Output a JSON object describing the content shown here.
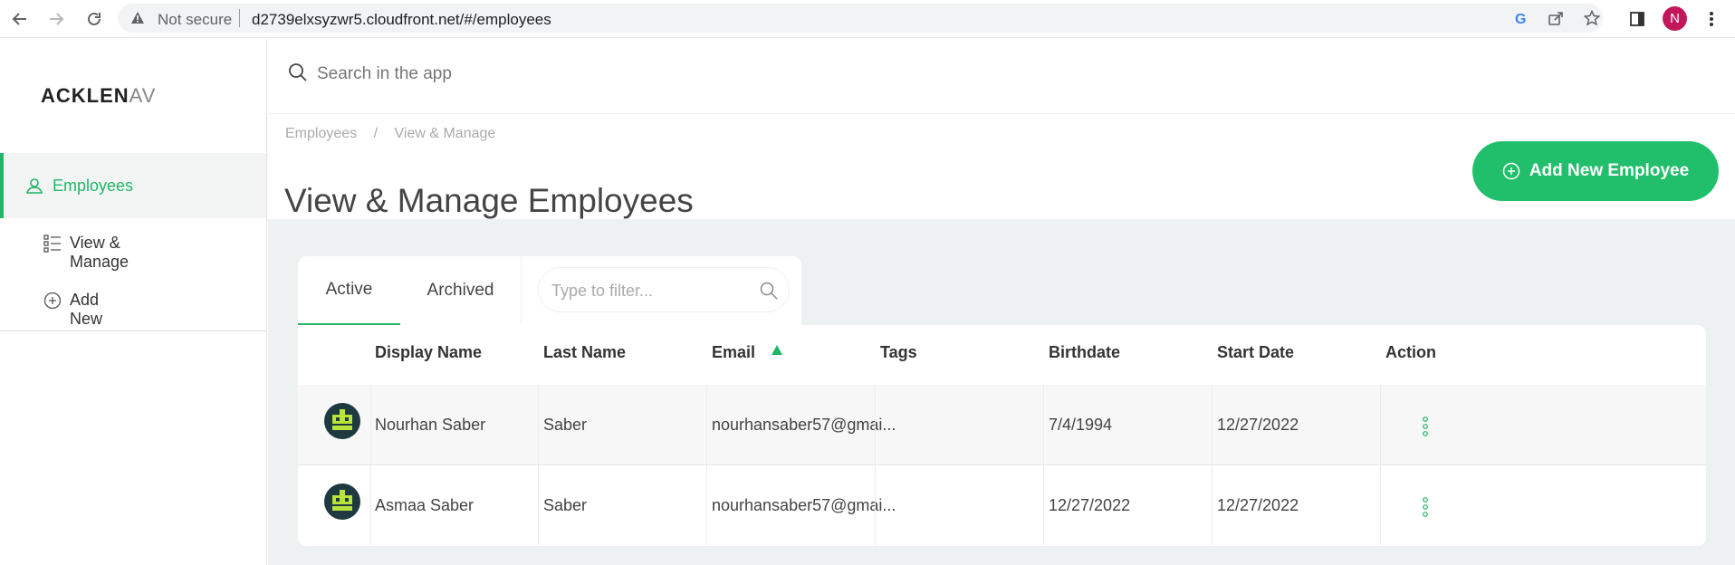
{
  "browser": {
    "not_secure": "Not secure",
    "url": "d2739elxsyzwr5.cloudfront.net/#/employees",
    "profile_initial": "N"
  },
  "sidebar": {
    "logo_main": "ACKLEN",
    "logo_faded": "AV",
    "items": [
      {
        "label": "Employees",
        "icon": "user-icon",
        "active": true
      },
      {
        "label": "View & Manage",
        "icon": "list-icon"
      },
      {
        "label": "Add New",
        "icon": "plus-circle-icon"
      }
    ]
  },
  "topbar": {
    "search_placeholder": "Search in the app"
  },
  "header": {
    "breadcrumb": [
      "Employees",
      "/",
      "View & Manage"
    ],
    "title": "View & Manage Employees",
    "add_button": "Add New Employee"
  },
  "tabs": {
    "active": "Active",
    "archived": "Archived",
    "filter_placeholder": "Type to filter..."
  },
  "table": {
    "columns": [
      "Display Name",
      "Last Name",
      "Email",
      "Tags",
      "Birthdate",
      "Start Date",
      "Action"
    ],
    "rows": [
      {
        "display_name": "Nourhan Saber",
        "last_name": "Saber",
        "email": "nourhansaber57@gmai...",
        "tags": "",
        "birthdate": "7/4/1994",
        "start_date": "12/27/2022"
      },
      {
        "display_name": "Asmaa Saber",
        "last_name": "Saber",
        "email": "nourhansaber57@gmai...",
        "tags": "",
        "birthdate": "12/27/2022",
        "start_date": "12/27/2022"
      }
    ]
  },
  "colors": {
    "accent": "#21b567",
    "button": "#21bf6b",
    "avatar_bg": "#1e3a40",
    "avatar_fg": "#b7e33a",
    "profile": "#c2185b"
  }
}
